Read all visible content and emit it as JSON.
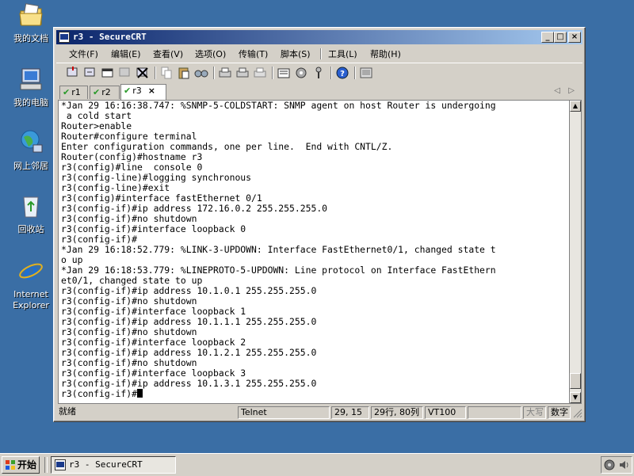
{
  "desktop": {
    "icons": [
      {
        "label": "我的文档",
        "icon": "folder-documents-icon"
      },
      {
        "label": "我的电脑",
        "icon": "computer-icon"
      },
      {
        "label": "网上邻居",
        "icon": "network-icon"
      },
      {
        "label": "回收站",
        "icon": "recycle-bin-icon"
      },
      {
        "label": "Internet Explorer",
        "icon": "internet-explorer-icon"
      }
    ]
  },
  "window": {
    "title": "r3 - SecureCRT",
    "controls": {
      "minimize": "_",
      "maximize": "□",
      "close": "×"
    }
  },
  "menu": {
    "items": [
      "文件(F)",
      "编辑(E)",
      "查看(V)",
      "选项(O)",
      "传输(T)",
      "脚本(S)",
      "工具(L)",
      "帮助(H)"
    ]
  },
  "tabs": [
    {
      "label": "r1",
      "active": false
    },
    {
      "label": "r2",
      "active": false
    },
    {
      "label": "r3",
      "active": true,
      "close": "×"
    }
  ],
  "tab_nav": {
    "prev": "◁",
    "next": "▷"
  },
  "terminal": {
    "lines": [
      "*Jan 29 16:16:38.747: %SNMP-5-COLDSTART: SNMP agent on host Router is undergoing",
      " a cold start",
      "Router>enable",
      "Router#configure terminal",
      "Enter configuration commands, one per line.  End with CNTL/Z.",
      "Router(config)#hostname r3",
      "r3(config)#line  console 0",
      "r3(config-line)#logging synchronous",
      "r3(config-line)#exit",
      "r3(config)#interface fastEthernet 0/1",
      "r3(config-if)#ip address 172.16.0.2 255.255.255.0",
      "r3(config-if)#no shutdown",
      "r3(config-if)#interface loopback 0",
      "r3(config-if)#",
      "*Jan 29 16:18:52.779: %LINK-3-UPDOWN: Interface FastEthernet0/1, changed state t",
      "o up",
      "*Jan 29 16:18:53.779: %LINEPROTO-5-UPDOWN: Line protocol on Interface FastEthern",
      "et0/1, changed state to up",
      "r3(config-if)#ip address 10.1.0.1 255.255.255.0",
      "r3(config-if)#no shutdown",
      "r3(config-if)#interface loopback 1",
      "r3(config-if)#ip address 10.1.1.1 255.255.255.0",
      "r3(config-if)#no shutdown",
      "r3(config-if)#interface loopback 2",
      "r3(config-if)#ip address 10.1.2.1 255.255.255.0",
      "r3(config-if)#no shutdown",
      "r3(config-if)#interface loopback 3",
      "r3(config-if)#ip address 10.1.3.1 255.255.255.0"
    ],
    "prompt": "r3(config-if)#"
  },
  "status": {
    "ready": "就绪",
    "protocol": "Telnet",
    "cursor_pos": "29, 15",
    "size": "29行, 80列",
    "emulation": "VT100",
    "empty": "",
    "caps": "大写",
    "num": "数字"
  },
  "taskbar": {
    "start": "开始",
    "task": "r3 - SecureCRT"
  }
}
